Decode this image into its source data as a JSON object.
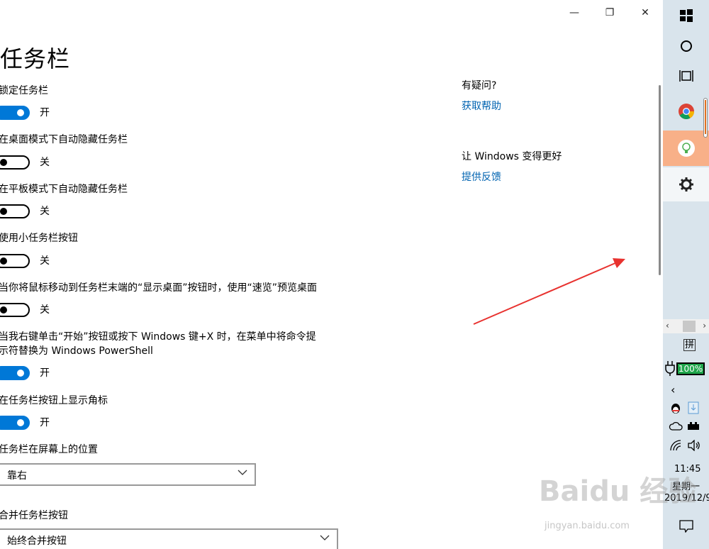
{
  "window": {
    "title": "任务栏",
    "controls": {
      "minimize": "—",
      "restore": "❐",
      "close": "✕"
    }
  },
  "settings": [
    {
      "label": "锁定任务栏",
      "type": "toggle",
      "on": true,
      "state": "开"
    },
    {
      "label": "在桌面模式下自动隐藏任务栏",
      "type": "toggle",
      "on": false,
      "state": "关"
    },
    {
      "label": "在平板模式下自动隐藏任务栏",
      "type": "toggle",
      "on": false,
      "state": "关"
    },
    {
      "label": "使用小任务栏按钮",
      "type": "toggle",
      "on": false,
      "state": "关"
    },
    {
      "label": "当你将鼠标移动到任务栏末端的“显示桌面”按钮时，使用“速览”预览桌面",
      "type": "toggle",
      "on": false,
      "state": "关"
    },
    {
      "label_line1": "当我右键单击“开始”按钮或按下 Windows 键+X 时，在菜单中将命令提",
      "label_line2": "示符替换为 Windows PowerShell",
      "type": "toggle",
      "on": true,
      "state": "开"
    },
    {
      "label": "在任务栏按钮上显示角标",
      "type": "toggle",
      "on": true,
      "state": "开"
    }
  ],
  "position": {
    "label": "任务栏在屏幕上的位置",
    "value": "靠右"
  },
  "combine": {
    "label": "合并任务栏按钮",
    "value": "始终合并按钮"
  },
  "side": {
    "help_heading": "有疑问?",
    "help_link": "获取帮助",
    "feedback_heading": "让 Windows 变得更好",
    "feedback_link": "提供反馈"
  },
  "taskbar": {
    "ime": "拼",
    "battery": "100%",
    "time": "11:45",
    "weekday": "星期一",
    "date": "2019/12/9"
  },
  "watermark": {
    "main": "Baidu 经验",
    "sub": "jingyan.baidu.com"
  },
  "colors": {
    "accent": "#0078d7",
    "link": "#0063b1",
    "taskbar": "#d9e4ec",
    "annotation_arrow": "#e8322f"
  }
}
